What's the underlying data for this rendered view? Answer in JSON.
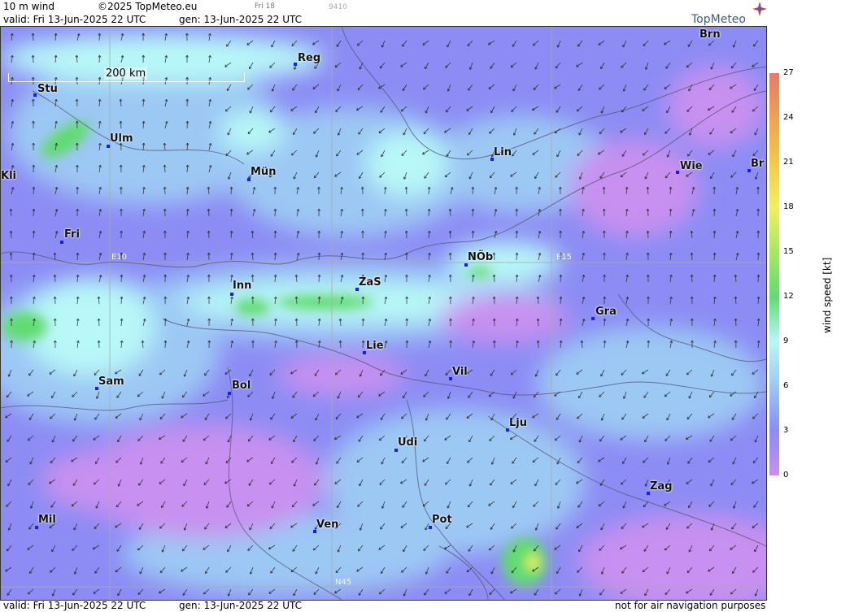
{
  "header": {
    "title": "10 m wind",
    "copyright": "©2025 TopMeteo.eu",
    "day_tag": "Fri 18",
    "code": "9410",
    "valid": "valid:  Fri  13-Jun-2025  22 UTC",
    "gen": "gen: 13-Jun-2025  22 UTC",
    "logo": "TopMeteo"
  },
  "footer": {
    "valid": "valid:  Fri  13-Jun-2025  22 UTC",
    "gen": "gen: 13-Jun-2025  22 UTC",
    "note": "not for air navigation purposes"
  },
  "map": {
    "scale_label": "200 km",
    "grid_labels": {
      "e10": "E10",
      "e15": "E15",
      "n45": "N45"
    },
    "cities": [
      {
        "name": "Stu"
      },
      {
        "name": "Ulm"
      },
      {
        "name": "Kli"
      },
      {
        "name": "Mün"
      },
      {
        "name": "Reg"
      },
      {
        "name": "Brn"
      },
      {
        "name": "Lin"
      },
      {
        "name": "Wie"
      },
      {
        "name": "Br"
      },
      {
        "name": "Fri"
      },
      {
        "name": "Inn"
      },
      {
        "name": "ZaS"
      },
      {
        "name": "NÖb"
      },
      {
        "name": "Gra"
      },
      {
        "name": "Lie"
      },
      {
        "name": "Vil"
      },
      {
        "name": "Sam"
      },
      {
        "name": "Bol"
      },
      {
        "name": "Lju"
      },
      {
        "name": "Udi"
      },
      {
        "name": "Zag"
      },
      {
        "name": "Mil"
      },
      {
        "name": "Ven"
      },
      {
        "name": "Pot"
      }
    ]
  },
  "legend": {
    "unit": "wind  speed  [kt]",
    "ticks": [
      "27",
      "24",
      "21",
      "18",
      "15",
      "12",
      "9",
      "6",
      "3",
      "0"
    ],
    "colors": [
      "#e87a6a",
      "#f0a050",
      "#f4c848",
      "#f0f060",
      "#a8e860",
      "#60dc70",
      "#b8f8f8",
      "#9cc8f4",
      "#8c8cf4",
      "#c890f0"
    ]
  }
}
